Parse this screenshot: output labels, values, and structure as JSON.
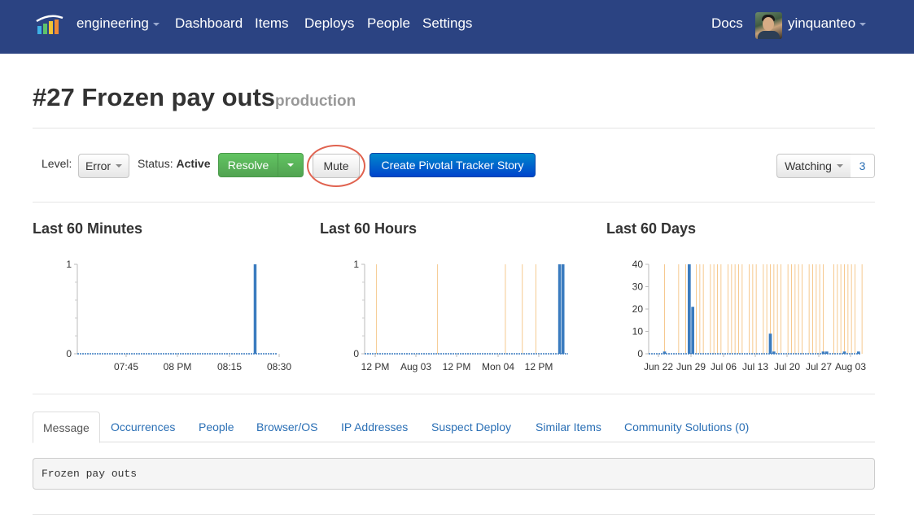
{
  "nav": {
    "project": "engineering",
    "links": [
      "Dashboard",
      "Items",
      "Deploys",
      "People",
      "Settings"
    ],
    "docs": "Docs",
    "username": "yinquanteo",
    "bg_color": "#2b4382"
  },
  "item": {
    "title": "#27 Frozen pay outs",
    "environment": "production"
  },
  "toolbar": {
    "level_label": "Level:",
    "level_value": "Error",
    "status_label": "Status:",
    "status_value": "Active",
    "resolve_label": "Resolve",
    "mute_label": "Mute",
    "pivotal_label": "Create Pivotal Tracker Story",
    "watching_label": "Watching",
    "watching_count": "3"
  },
  "charts": {
    "minutes_title": "Last 60 Minutes",
    "hours_title": "Last 60 Hours",
    "days_title": "Last 60 Days"
  },
  "chart_data": [
    {
      "type": "bar",
      "title": "Last 60 Minutes",
      "ylim": [
        0,
        1
      ],
      "y_ticks": [
        "0",
        "1"
      ],
      "x_ticks": [
        "07:45",
        "08 PM",
        "08:15",
        "08:30"
      ],
      "bar_series": {
        "n": 60,
        "values": [
          [
            54,
            1
          ]
        ]
      },
      "deploy_markers": []
    },
    {
      "type": "bar",
      "title": "Last 60 Hours",
      "ylim": [
        0,
        1
      ],
      "y_ticks": [
        "0",
        "1"
      ],
      "x_ticks": [
        "12 PM",
        "Aug 03",
        "12 PM",
        "Mon 04",
        "12 PM"
      ],
      "bar_series": {
        "n": 60,
        "values": [
          [
            58,
            1
          ],
          [
            59,
            1
          ]
        ]
      },
      "deploy_markers": [
        4,
        22,
        42,
        47,
        51
      ]
    },
    {
      "type": "bar",
      "title": "Last 60 Days",
      "ylim": [
        0,
        40
      ],
      "y_ticks": [
        "0",
        "10",
        "20",
        "30",
        "40"
      ],
      "x_ticks": [
        "Jun 22",
        "Jun 29",
        "Jul 06",
        "Jul 13",
        "Jul 20",
        "Jul 27",
        "Aug 03"
      ],
      "bar_series": {
        "n": 60,
        "values": [
          [
            5,
            1
          ],
          [
            12,
            40
          ],
          [
            13,
            21
          ],
          [
            35,
            9
          ],
          [
            36,
            1
          ],
          [
            50,
            1
          ],
          [
            51,
            1
          ],
          [
            56,
            1
          ],
          [
            60,
            1
          ]
        ]
      },
      "deploy_markers": [
        5,
        9,
        11,
        12,
        14,
        15,
        16,
        18,
        19,
        20,
        21,
        23,
        24,
        25,
        26,
        27,
        29,
        30,
        31,
        33,
        34,
        35,
        36,
        37,
        38,
        40,
        41,
        42,
        43,
        44,
        46,
        47,
        48,
        49,
        50,
        53,
        54,
        55,
        56,
        57,
        58,
        59,
        61
      ]
    }
  ],
  "tabs": [
    "Message",
    "Occurrences",
    "People",
    "Browser/OS",
    "IP Addresses",
    "Suspect Deploy",
    "Similar Items",
    "Community Solutions (0)"
  ],
  "message": "Frozen pay outs",
  "colors": {
    "bar": "#3a7bbf",
    "deploy_marker": "#f6c98f",
    "resolve": "#5bb75b",
    "pivotal": "#0a5fc8",
    "mute_highlight": "#e0624f",
    "link": "#2a6fb5"
  }
}
